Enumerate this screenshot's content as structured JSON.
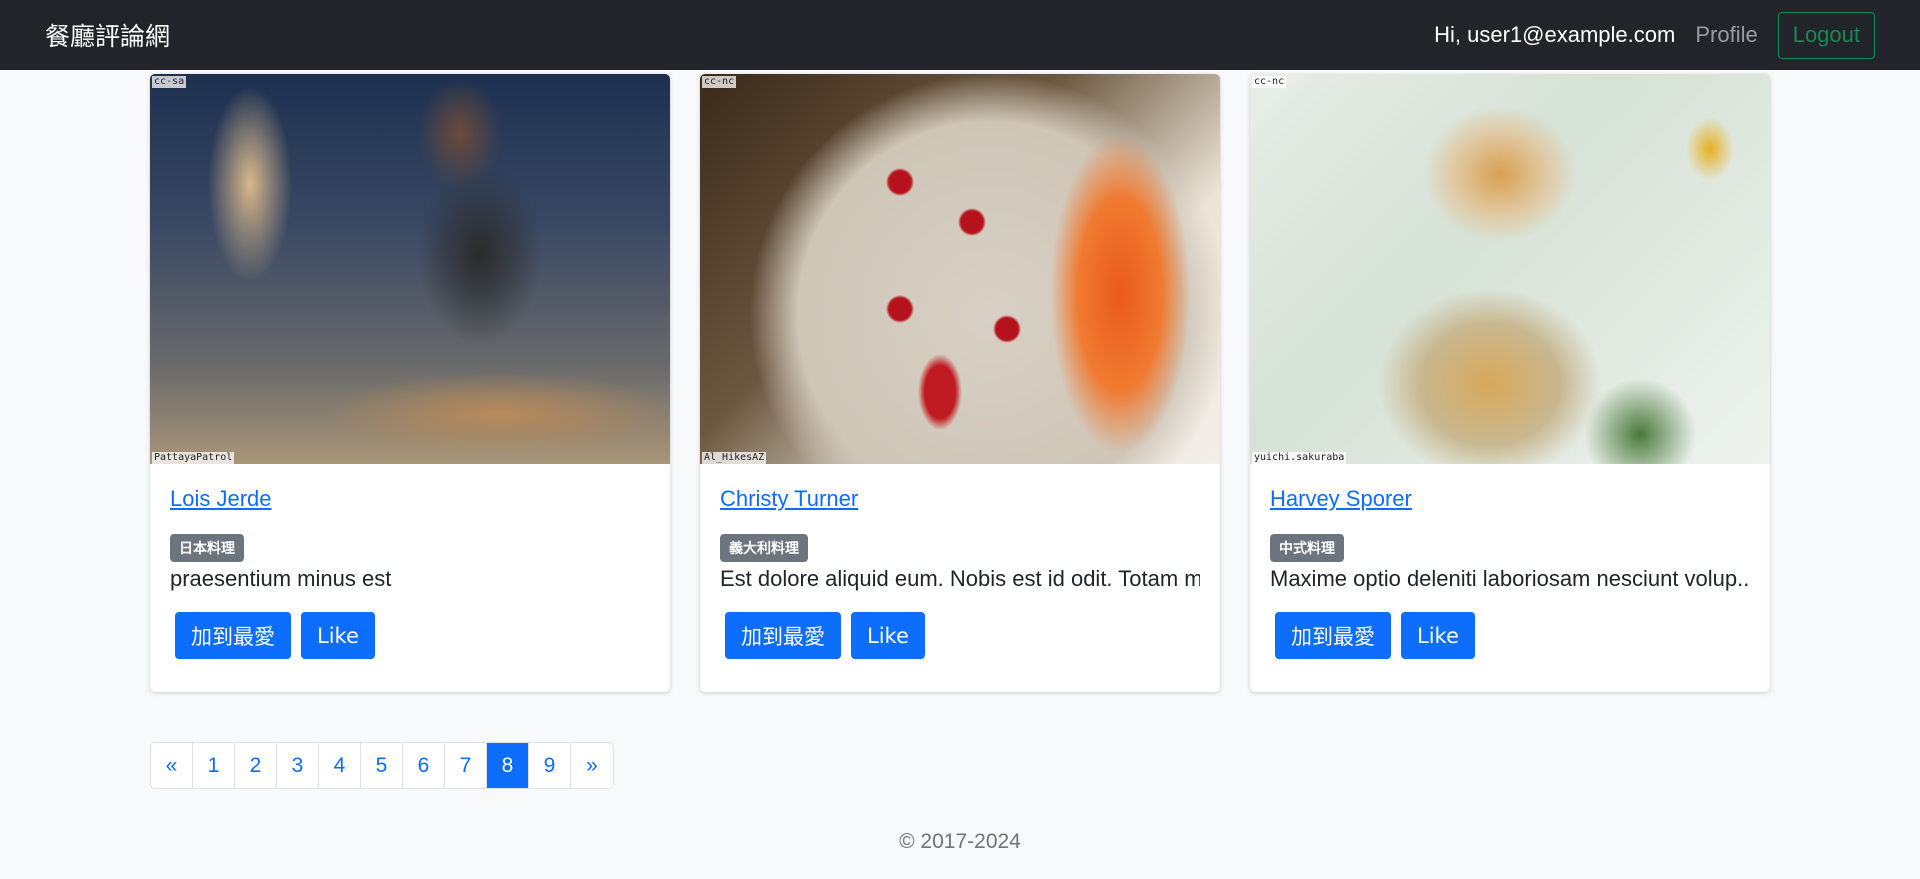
{
  "navbar": {
    "brand": "餐廳評論網",
    "greeting": "Hi, user1@example.com",
    "profile": "Profile",
    "logout": "Logout"
  },
  "cards": [
    {
      "title": "Lois Jerde",
      "category": "日本料理",
      "description": "praesentium minus est",
      "license": "cc-sa",
      "credit": "PattayaPatrol",
      "favorite_label": "加到最愛",
      "like_label": "Like"
    },
    {
      "title": "Christy Turner",
      "category": "義大利料理",
      "description": "Est dolore aliquid eum. Nobis est id odit. Totam m",
      "license": "cc-nc",
      "credit": "Al_HikesAZ",
      "favorite_label": "加到最愛",
      "like_label": "Like"
    },
    {
      "title": "Harvey Sporer",
      "category": "中式料理",
      "description": "Maxime optio deleniti laboriosam nesciunt volup...",
      "license": "cc-nc",
      "credit": "yuichi.sakuraba",
      "favorite_label": "加到最愛",
      "like_label": "Like"
    }
  ],
  "pagination": {
    "prev": "«",
    "pages": [
      "1",
      "2",
      "3",
      "4",
      "5",
      "6",
      "7",
      "8",
      "9"
    ],
    "current": "8",
    "next": "»"
  },
  "footer": {
    "copyright": "© 2017-2024"
  },
  "colors": {
    "primary": "#0d6efd",
    "navbar_bg": "#212529",
    "badge_bg": "#6c757d",
    "logout_outline": "#198754"
  }
}
